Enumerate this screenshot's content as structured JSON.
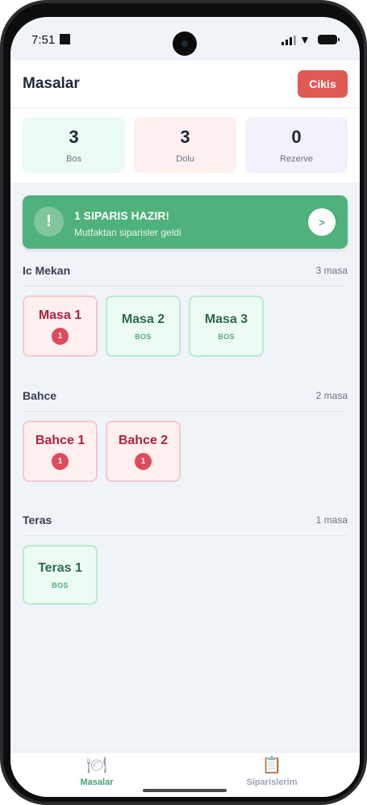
{
  "status_bar": {
    "time": "7:51"
  },
  "header": {
    "title": "Masalar",
    "logout_label": "Cikis"
  },
  "stats": [
    {
      "value": "3",
      "label": "Bos"
    },
    {
      "value": "3",
      "label": "Dolu"
    },
    {
      "value": "0",
      "label": "Rezerve"
    }
  ],
  "notification": {
    "icon": "!",
    "title": "1 SIPARIS HAZIR!",
    "subtitle": "Mutfaktan siparisler geldi",
    "action": ">"
  },
  "sections": [
    {
      "name": "Ic Mekan",
      "count": "3 masa",
      "tables": [
        {
          "name": "Masa 1",
          "state": "full",
          "badge": "1"
        },
        {
          "name": "Masa 2",
          "state": "empty",
          "status": "BOS"
        },
        {
          "name": "Masa 3",
          "state": "empty",
          "status": "BOS"
        }
      ]
    },
    {
      "name": "Bahce",
      "count": "2 masa",
      "tables": [
        {
          "name": "Bahce 1",
          "state": "full",
          "badge": "1"
        },
        {
          "name": "Bahce 2",
          "state": "full",
          "badge": "1"
        }
      ]
    },
    {
      "name": "Teras",
      "count": "1 masa",
      "tables": [
        {
          "name": "Teras 1",
          "state": "empty",
          "status": "BOS"
        }
      ]
    }
  ],
  "bottom_nav": [
    {
      "label": "Masalar",
      "icon": "plate-utensils-icon",
      "active": true
    },
    {
      "label": "Siparislerim",
      "icon": "clipboard-icon",
      "active": false
    }
  ],
  "colors": {
    "accent_green": "#4fb17b",
    "danger_red": "#e05a55",
    "occupied_text": "#b3213f",
    "empty_text": "#2d6a4c"
  }
}
